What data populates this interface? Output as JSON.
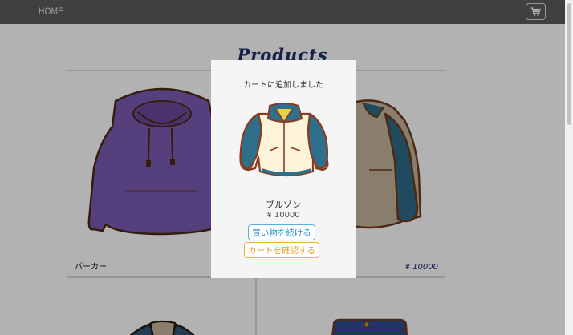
{
  "nav": {
    "home": "HOME",
    "cart_icon": "cart-icon"
  },
  "page": {
    "title": "Products"
  },
  "products": [
    {
      "name": "パーカー",
      "price": ""
    },
    {
      "name": "",
      "price": "¥ 10000"
    },
    {
      "name": "",
      "price": ""
    },
    {
      "name": "",
      "price": ""
    }
  ],
  "modal": {
    "message": "カートに追加しました",
    "product_name": "ブルゾン",
    "product_price": "¥ 10000",
    "continue_label": "買い物を続ける",
    "confirm_label": "カートを確認する"
  },
  "colors": {
    "navbar": "#5c5c5c",
    "title": "#1e2f6e",
    "continue_button": "#2d8ec9",
    "confirm_button": "#e49a1c"
  }
}
